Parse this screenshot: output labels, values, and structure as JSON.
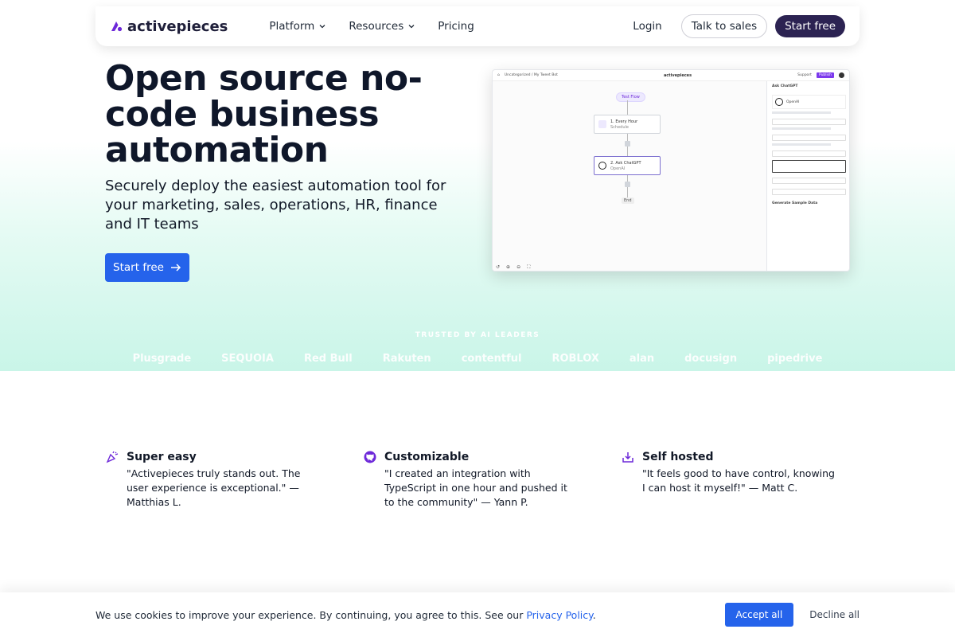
{
  "nav": {
    "logo_text": "activepieces",
    "links": [
      {
        "label": "Platform"
      },
      {
        "label": "Resources"
      },
      {
        "label": "Pricing"
      }
    ],
    "login": "Login",
    "talk_to_sales": "Talk to sales",
    "start_free": "Start free"
  },
  "hero": {
    "title": "Open source no-code business automation",
    "subtitle": "Securely deploy the easiest automation tool for your marketing, sales, operations, HR, finance and IT teams",
    "cta": "Start free"
  },
  "mockup": {
    "breadcrumb": "Uncategorized / My Tweet Bot",
    "brand": "activepieces",
    "support": "Support",
    "publish": "Publish",
    "test_flow": "Test Flow",
    "step1_title": "1. Every Hour",
    "step1_sub": "Schedule",
    "step2_title": "2. Ask ChatGPT",
    "step2_sub": "OpenAI",
    "end": "End",
    "side_title": "Ask ChatGPT",
    "side_app": "OpenAI",
    "side_sample": "Generate Sample Data"
  },
  "trusted": {
    "heading": "TRUSTED BY AI LEADERS",
    "logos": [
      "Plusgrade",
      "SEQUOIA",
      "Red Bull",
      "Rakuten",
      "contentful",
      "ROBLOX",
      "alan",
      "docusign",
      "pipedrive"
    ]
  },
  "features": [
    {
      "title": "Super easy",
      "text": "\"Activepieces truly stands out. The user experience is exceptional.\" — Matthias L."
    },
    {
      "title": "Customizable",
      "text": "\"I created an integration with TypeScript in one hour and pushed it to the community\" — Yann P."
    },
    {
      "title": "Self hosted",
      "text": "\"It feels good to have control, knowing I can host it myself!\" — Matt C."
    }
  ],
  "cookie": {
    "text": "We use cookies to improve your experience. By continuing, you agree to this. See our",
    "link": "Privacy Policy",
    "after": ".",
    "accept": "Accept all",
    "decline": "Decline all"
  },
  "colors": {
    "primary": "#2563eb",
    "dark_button": "#2c2352",
    "brand_purple": "#6d28d9"
  }
}
